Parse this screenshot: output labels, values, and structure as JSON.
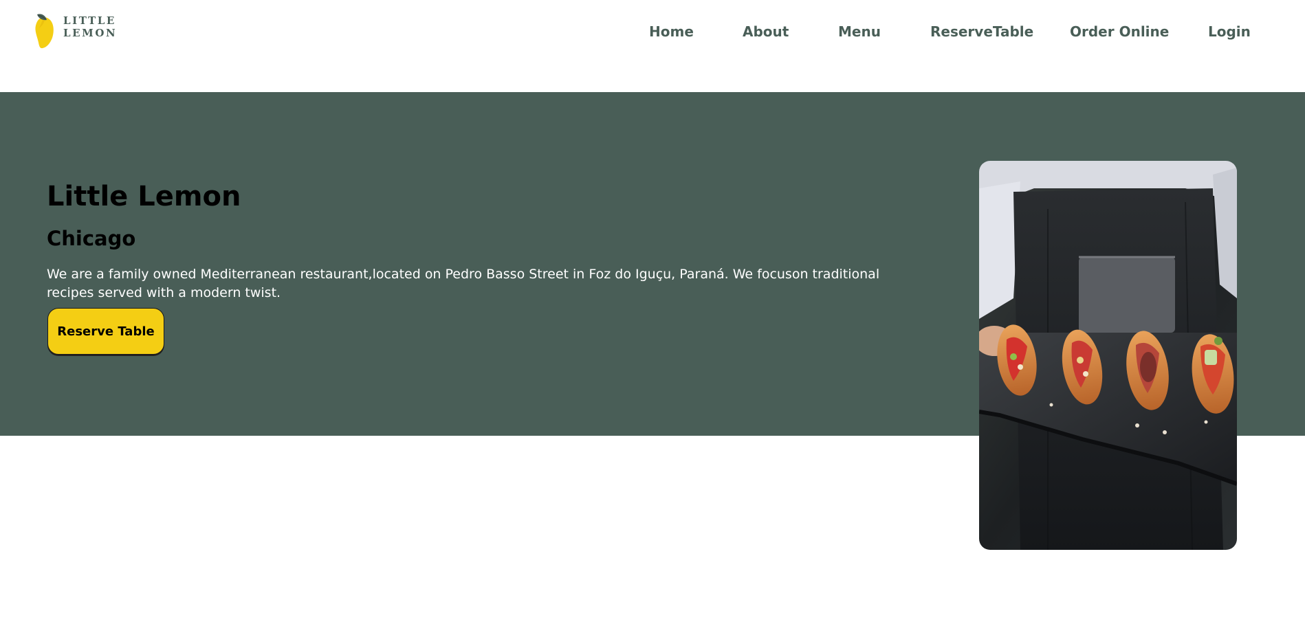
{
  "brand": {
    "logo_text": "LITTLE LEMON"
  },
  "nav": {
    "items": [
      {
        "label": "Home"
      },
      {
        "label": "About"
      },
      {
        "label": "Menu"
      },
      {
        "label": "ReserveTable"
      },
      {
        "label": "Order Online"
      },
      {
        "label": "Login"
      }
    ]
  },
  "hero": {
    "title": "Little Lemon",
    "subtitle": "Chicago",
    "description": "We are a family owned Mediterranean restaurant,located on Pedro Basso Street in Foz do Iguçu, Paraná. We focuson traditional recipes served with a modern twist.",
    "button_label": "Reserve Table",
    "image_icon": "food-platter-photo"
  },
  "colors": {
    "primary_green": "#495e57",
    "primary_yellow": "#f4ce14",
    "white": "#ffffff",
    "black": "#000000"
  }
}
